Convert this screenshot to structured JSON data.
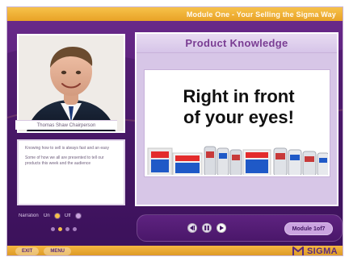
{
  "window": {
    "title": "Module One - Your Selling the Sigma Way"
  },
  "presenter": {
    "caption": "Thomas Shaw Chairperson",
    "notes": [
      "Knowing how to sell is always fast and an easy",
      "Some of how we all are presented to tell our products this week and the audience"
    ]
  },
  "audio": {
    "label": "Narration",
    "on_label": "On",
    "off_label": "Off"
  },
  "main": {
    "section_title": "Product Knowledge",
    "slide_headline": "Right in front\nof your eyes!"
  },
  "controls": {
    "module_button": "Module 1of7"
  },
  "footer": {
    "buttons": [
      "EXIT",
      "MENU"
    ],
    "brand": "SIGMA"
  },
  "colors": {
    "accent_orange": "#e8a227",
    "brand_purple": "#5b2b7a",
    "panel_lilac": "#d7c6e7"
  },
  "icons": {
    "rewind": "rewind-icon",
    "pause": "pause-icon",
    "play": "play-icon",
    "brand_logo": "sigma-logo-icon"
  }
}
